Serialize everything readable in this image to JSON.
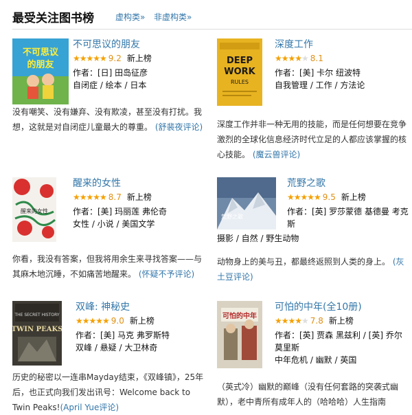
{
  "header": {
    "title": "最受关注图书榜",
    "links": [
      "虚构类»",
      "非虚构类»"
    ]
  },
  "books": [
    {
      "title": "不可思议的朋友",
      "stars": 4.5,
      "score": "9.2",
      "tag": "新上榜",
      "author": "作者：[日] 田岛征彦",
      "cats": "自闭症 / 绘本 / 日本",
      "desc": "没有嘲笑、没有嫌弃、没有欺凌，甚至没有打扰。我想，这就是对自闭症儿童最大的尊重。",
      "reviewer": "(舒裴夜评论)",
      "cover_text": "不可思议的朋友"
    },
    {
      "title": "深度工作",
      "stars": 4,
      "score": "8.1",
      "tag": "",
      "author": "作者：[美] 卡尔 纽波特",
      "cats": "自我管理 / 工作 / 方法论",
      "desc": "深度工作并非一种无用的技能，而是任何想要在竞争激烈的全球化信息经济时代立足的人都应该掌握的核心技能。",
      "reviewer": "(魔云兽评论)",
      "cover_text": "DEEP WORK RULES"
    },
    {
      "title": "醒来的女性",
      "stars": 4.5,
      "score": "8.7",
      "tag": "新上榜",
      "author": "作者：[美] 玛丽莲 弗伦奇",
      "cats": "女性 / 小说 / 美国文学",
      "desc": "你看，我没有答案，但我将用余生来寻找答案——与其麻木地沉睡，不如痛苦地醒来。",
      "reviewer": "(怀疑不予评论)",
      "cover_text": "醒来的女性"
    },
    {
      "title": "荒野之歌",
      "stars": 5,
      "score": "9.5",
      "tag": "新上榜",
      "author": "作者：[英] 罗莎蒙德 基德曼 考克斯",
      "cats": "摄影 / 自然 / 野生动物",
      "desc": "动物身上的美与丑，都最终返照到人类的身上。",
      "reviewer": "(灰土豆评论)",
      "cover_text": "荒野之歌"
    },
    {
      "title": "双峰: 神秘史",
      "stars": 4.5,
      "score": "9.0",
      "tag": "新上榜",
      "author": "作者：[美] 马克 弗罗斯特",
      "cats": "双峰 / 悬疑 / 大卫林奇",
      "desc": "历史的秘密以一连串Mayday结束，《双峰镇》，25年后，也正式向我们发出讯号：Welcome back to Twin Peaks!",
      "reviewer": "(April Yue评论)",
      "cover_text": "TWIN PEAKS"
    },
    {
      "title": "可怕的中年(全10册)",
      "stars": 4,
      "score": "7.8",
      "tag": "新上榜",
      "author": "作者：[英] 贾森 黑兹利 / [英] 乔尔 莫里斯",
      "cats": "中年危机 / 幽默 / 英国",
      "desc": "（英式冷）幽默的巅峰（没有任何套路的突袭式幽默），老中青所有成年人的（哈哈哈）人生指南",
      "reviewer": "",
      "cover_text": "可怕的中年"
    }
  ],
  "colors": {
    "link": "#3377aa",
    "star": "#f5a000",
    "score": "#e09015"
  }
}
